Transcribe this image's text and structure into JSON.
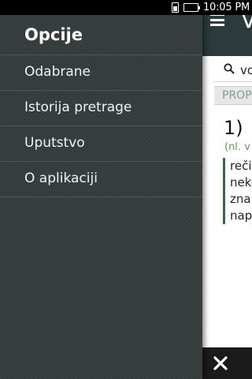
{
  "status_bar": {
    "time": "10:05 PM",
    "icons": [
      "sim-icon",
      "battery-icon"
    ],
    "battery_color": "#3fcf3f"
  },
  "drawer": {
    "title": "Opcije",
    "items": [
      {
        "label": "Odabrane"
      },
      {
        "label": "Istorija pretrage"
      },
      {
        "label": "Uputstvo"
      },
      {
        "label": "O aplikaciji"
      }
    ]
  },
  "app": {
    "title": "V",
    "search_value": "vo",
    "section_tab": "PROP",
    "entry": {
      "number": "1)",
      "origin": "(nl. v",
      "definition_lines": [
        "reči",
        "neko",
        "zna",
        "napi"
      ]
    }
  },
  "colors": {
    "drawer_bg": "#343c3c",
    "app_bar_bg": "#2b3a3a",
    "accent_green": "#2e6b3f",
    "origin_green": "#5f9b5f"
  }
}
